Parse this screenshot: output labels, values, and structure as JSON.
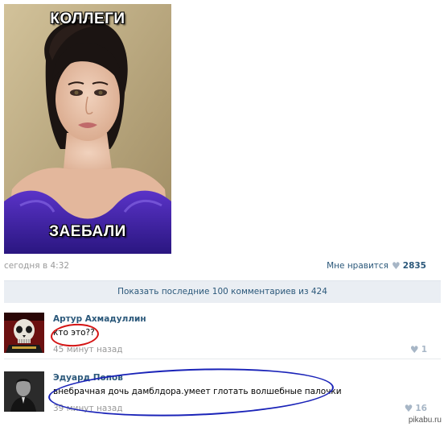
{
  "post": {
    "meme_top": "КОЛЛЕГИ",
    "meme_bottom": "ЗАЕБАЛИ",
    "time": "сегодня в 4:32",
    "like_label": "Мне нравится",
    "like_count": "2835",
    "like_icon": "heart-icon"
  },
  "show_more": "Показать последние 100 комментариев из 424",
  "comments": [
    {
      "author": "Артур Ахмадуллин",
      "text": "кто это??",
      "time": "45 минут назад",
      "likes": "1",
      "highlight_color": "#d41414"
    },
    {
      "author": "Эдуард Попов",
      "text": "внебрачная дочь дамблдора.умеет глотать волшебные палочки",
      "time": "39 минут назад",
      "likes": "16",
      "highlight_color": "#1a23b8"
    }
  ],
  "watermark": "pikabu.ru"
}
